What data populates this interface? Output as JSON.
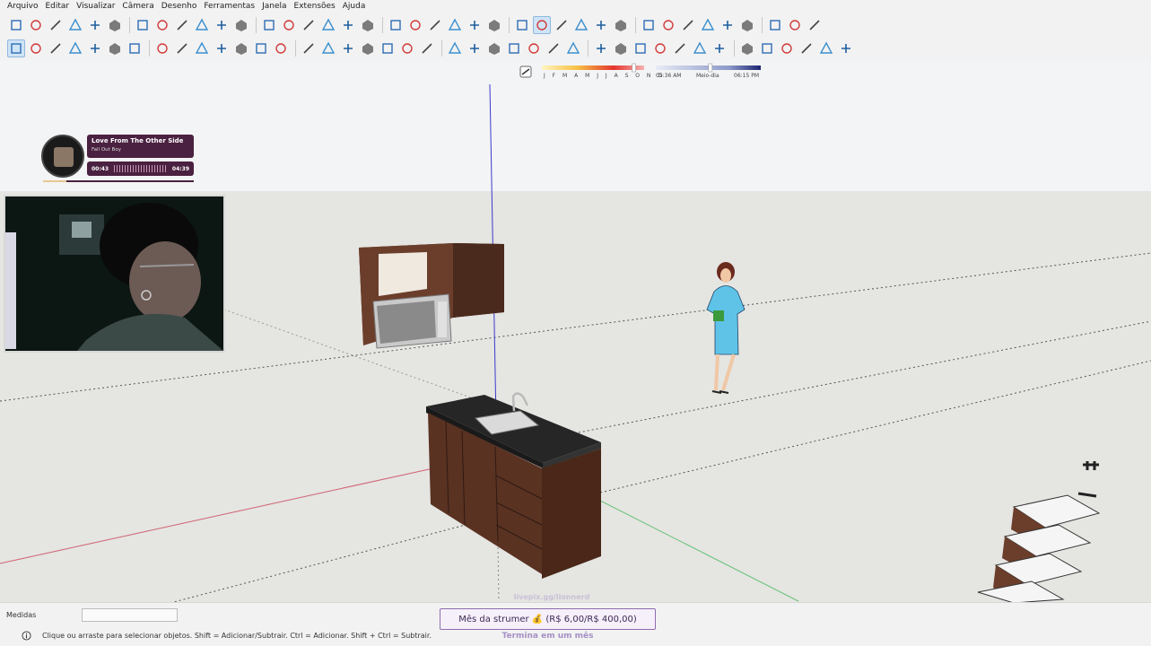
{
  "menu": [
    "Arquivo",
    "Editar",
    "Visualizar",
    "Câmera",
    "Desenho",
    "Ferramentas",
    "Janela",
    "Extensões",
    "Ajuda"
  ],
  "toolbar1_icons": [
    "new-file-icon",
    "open-file-icon",
    "save-icon",
    "cut-icon",
    "copy-icon",
    "paste-icon",
    "erase-icon",
    "undo-icon",
    "redo-icon",
    "print-icon",
    "model-info-icon",
    "iso-view-icon",
    "top-view-icon",
    "front-view-icon",
    "right-view-icon",
    "back-view-icon",
    "left-view-icon",
    "bottom-view-icon",
    "orbit-icon",
    "pan-icon",
    "zoom-icon",
    "zoom-extents-icon",
    "xray-icon",
    "wireframe-icon",
    "hidden-line-icon",
    "shaded-icon",
    "textured-icon",
    "monochrome-icon",
    "section-plane-icon",
    "section-display-icon",
    "warehouse-icon",
    "extension-icon",
    "layout-icon",
    "cloud-icon",
    "settings-icon",
    "components-icon",
    "info-icon",
    "cart-icon",
    "account-icon"
  ],
  "toolbar2_icons": [
    "select-icon",
    "component-icon",
    "paint-bucket-icon",
    "eraser-icon",
    "line-icon",
    "freehand-icon",
    "rectangle-icon",
    "rotated-rectangle-icon",
    "circle-icon",
    "polygon-icon",
    "arc-icon",
    "two-point-arc-icon",
    "three-point-arc-icon",
    "pie-icon",
    "move-icon",
    "push-pull-icon",
    "rotate-icon",
    "scale-icon",
    "follow-me-icon",
    "offset-icon",
    "tape-measure-icon",
    "dimension-icon",
    "protractor-icon",
    "text-icon",
    "axes-icon",
    "3d-text-icon",
    "orbit-tool-icon",
    "pan-tool-icon",
    "zoom-tool-icon",
    "zoom-window-icon",
    "previous-view-icon",
    "position-camera-icon",
    "look-around-icon",
    "walk-icon",
    "sandbox-icon",
    "box-icon",
    "solid-icon",
    "mirror-icon",
    "extrude-icon",
    "dimension-tool-icon",
    "more-icon"
  ],
  "shadow": {
    "months": "J F M A M J J A S O N D",
    "time_start": "05:36 AM",
    "time_mid": "Meio-dia",
    "time_end": "06:15 PM",
    "date_slider": 0.9,
    "time_slider": 0.52
  },
  "music": {
    "title": "Love From The Other Side",
    "artist": "Fall Out Boy",
    "elapsed": "00:43",
    "duration": "04:39",
    "progress": 0.154
  },
  "measure": {
    "label": "Medidas",
    "value": ""
  },
  "status": {
    "hint": "Clique ou arraste para selecionar objetos. Shift = Adicionar/Subtrair. Ctrl = Adicionar. Shift + Ctrl = Subtrair."
  },
  "goal": {
    "text": "Mês da strumer 💰 (R$ 6,00/R$ 400,00)",
    "sub": "Termina em um mês",
    "watermark": "livepix.gg/lionnerd"
  },
  "colors": {
    "sky": "#f3f4f5",
    "ground": "#e6e6e3",
    "wood": "#5a3222",
    "countertop": "#2a2a2a",
    "blue_axis": "#3a3acc",
    "red_axis": "#d06070",
    "green_axis": "#60c070",
    "figure_dress": "#5fc3e8"
  }
}
